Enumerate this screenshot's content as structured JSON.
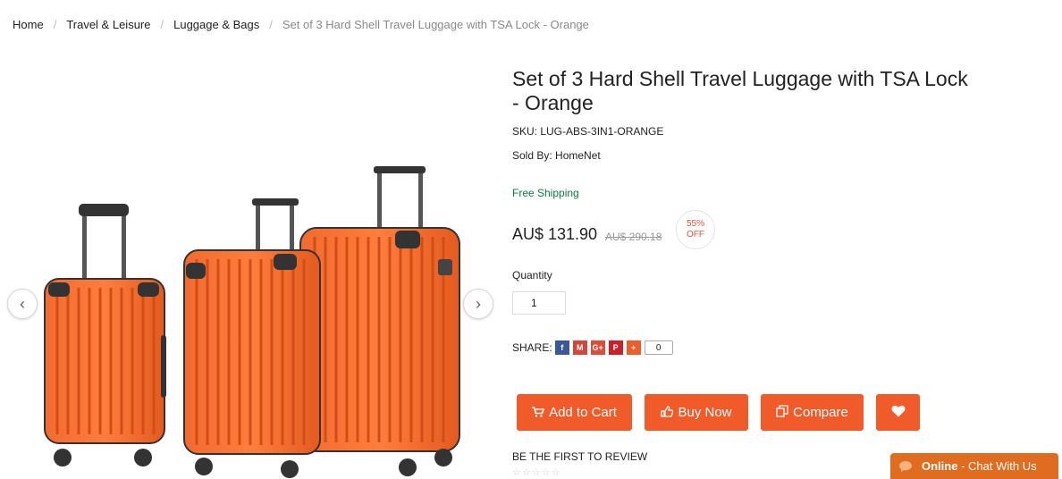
{
  "breadcrumb": {
    "items": [
      "Home",
      "Travel & Leisure",
      "Luggage & Bags"
    ],
    "current": "Set of 3 Hard Shell Travel Luggage with TSA Lock - Orange",
    "separator": "/"
  },
  "gallery": {
    "prev_icon": "chevron-left-icon",
    "next_icon": "chevron-right-icon",
    "prev_symbol": "‹",
    "next_symbol": "›"
  },
  "product": {
    "title": "Set of 3 Hard Shell Travel Luggage with TSA Lock - Orange",
    "sku": "SKU: LUG-ABS-3IN1-ORANGE",
    "sold_by": "Sold By: HomeNet",
    "shipping": "Free Shipping",
    "price": "AU$ 131.90",
    "old_price": "AU$ 290.18",
    "discount_percent": "55%",
    "discount_label": "OFF",
    "color": "#f15a29"
  },
  "quantity": {
    "label": "Quantity",
    "value": "1"
  },
  "share": {
    "label": "SHARE:",
    "buttons": [
      {
        "name": "facebook",
        "symbol": "f",
        "color": "#3b5998"
      },
      {
        "name": "gmail",
        "symbol": "M",
        "color": "#d44638"
      },
      {
        "name": "google-plus",
        "symbol": "G+",
        "color": "#dd4b39"
      },
      {
        "name": "pinterest",
        "symbol": "P",
        "color": "#cb2027"
      },
      {
        "name": "more",
        "symbol": "+",
        "color": "#f15a29"
      }
    ],
    "count": "0"
  },
  "actions": {
    "add_to_cart": "Add to Cart",
    "buy_now": "Buy Now",
    "compare": "Compare",
    "add_icon": "cart-icon",
    "buy_icon": "thumbs-up-icon",
    "compare_icon": "copy-icon",
    "wish_icon": "heart-icon",
    "accent": "#f15a29"
  },
  "review": {
    "label": "BE THE FIRST TO REVIEW",
    "stars": "☆☆☆☆☆",
    "rating": 0
  },
  "chat": {
    "status": "Online",
    "dash": " - ",
    "text": "Chat With Us",
    "color": "#e06d1f"
  }
}
